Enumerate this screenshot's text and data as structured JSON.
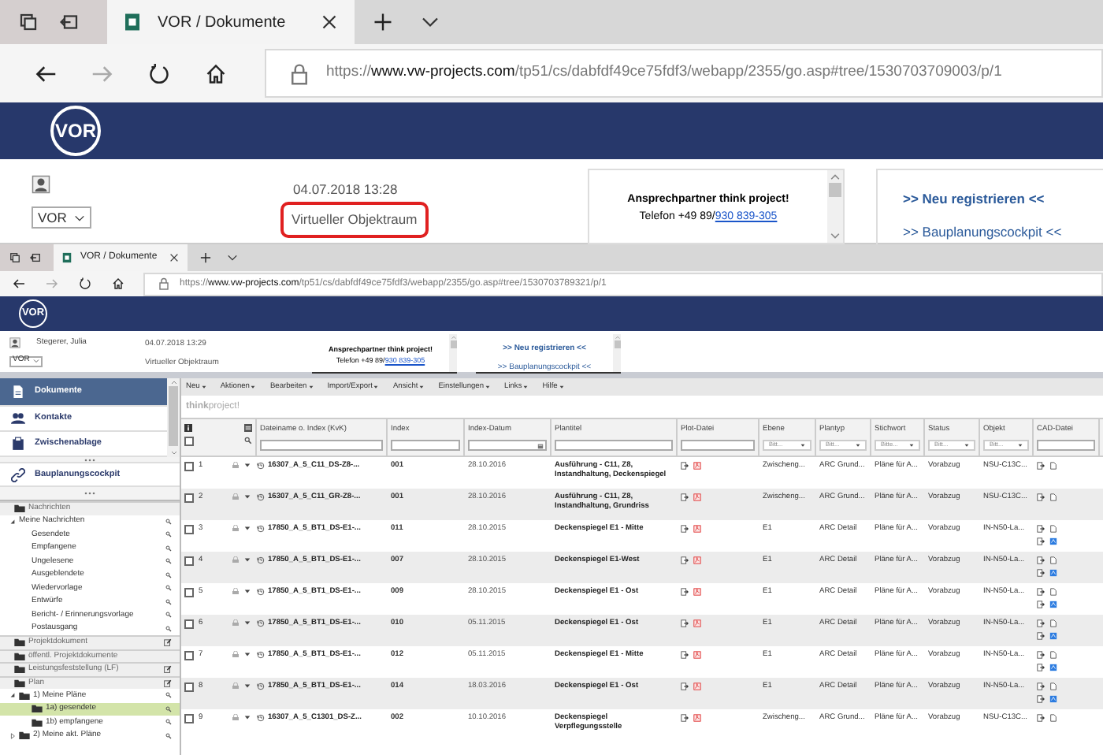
{
  "browser_outer": {
    "tab_title": "VOR / Dokumente",
    "url": {
      "scheme": "https://",
      "host": "www.vw-projects.com",
      "path": "/tp51/cs/dabfdf49ce75fdf3/webapp/2355/go.asp#tree/1530703709003/p/1"
    },
    "logo": "VOR",
    "project_select": "VOR",
    "date": "04.07.2018 13:28",
    "workspace": "Virtueller Objektraum",
    "workspace_highlighted": true,
    "contact": {
      "title": "Ansprechpartner think project!",
      "phone": "Telefon +49 89/",
      "phone_link": "930 839-305"
    },
    "links": [
      ">> Neu registrieren <<",
      ">> Bauplanungscockpit <<"
    ]
  },
  "browser_inner": {
    "tab_title": "VOR / Dokumente",
    "url": {
      "scheme": "https://",
      "host": "www.vw-projects.com",
      "path": "/tp51/cs/dabfdf49ce75fdf3/webapp/2355/go.asp#tree/1530703789321/p/1"
    },
    "logo": "VOR",
    "user": "Stegerer, Julia",
    "project_select": "VOR",
    "date": "04.07.2018 13:29",
    "workspace": "Virtueller Objektraum",
    "workspace_highlighted": false,
    "contact": {
      "title": "Ansprechpartner think project!",
      "phone": "Telefon +49 89/",
      "phone_link": "930 839-305"
    },
    "links": [
      ">> Neu registrieren <<",
      ">> Bauplanungscockpit <<"
    ]
  },
  "sidebar": {
    "nav": [
      {
        "label": "Dokumente",
        "kind": "document",
        "selected": true
      },
      {
        "label": "Kontakte",
        "kind": "contacts",
        "selected": false
      },
      {
        "label": "Zwischenablage",
        "kind": "clipboard",
        "selected": false
      }
    ],
    "cockpit": "Bauplanungscockpit",
    "tree": [
      {
        "label": "Nachrichten",
        "kind": "section",
        "selected": false,
        "children": [
          {
            "label": "Meine Nachrichten",
            "kind": "item",
            "search": true,
            "expanded": true,
            "selected": false,
            "children": [
              {
                "label": "Gesendete",
                "kind": "item",
                "search": true,
                "selected": false
              },
              {
                "label": "Empfangene",
                "kind": "item",
                "search": true,
                "selected": false
              },
              {
                "label": "Ungelesene",
                "kind": "item",
                "search": true,
                "selected": false
              },
              {
                "label": "Ausgeblendete",
                "kind": "item",
                "search": true,
                "selected": false
              },
              {
                "label": "Wiedervorlage",
                "kind": "item",
                "search": true,
                "selected": false
              },
              {
                "label": "Entwürfe",
                "kind": "item",
                "search": true,
                "selected": false
              },
              {
                "label": "Bericht- / Erinnerungsvorlage",
                "kind": "item",
                "search": true,
                "selected": false
              },
              {
                "label": "Postausgang",
                "kind": "item",
                "search": true,
                "selected": false
              }
            ]
          }
        ]
      },
      {
        "label": "Projektdokument",
        "kind": "section",
        "edit": true,
        "selected": false
      },
      {
        "label": "öffentl. Projektdokumente",
        "kind": "section",
        "selected": false
      },
      {
        "label": "Leistungsfeststellung (LF)",
        "kind": "section",
        "edit": true,
        "selected": false
      },
      {
        "label": "Plan",
        "kind": "section",
        "edit": true,
        "selected": false,
        "children": [
          {
            "label": "1) Meine Pläne",
            "kind": "folder",
            "search": true,
            "expanded": true,
            "selected": false,
            "children": [
              {
                "label": "1a) gesendete",
                "kind": "folder",
                "search": true,
                "selected": true
              },
              {
                "label": "1b) empfangene",
                "kind": "folder",
                "search": true,
                "selected": false
              }
            ]
          },
          {
            "label": "2) Meine akt. Pläne",
            "kind": "folder",
            "search": true,
            "expanded": false,
            "selected": false
          }
        ]
      }
    ]
  },
  "menu": [
    "Neu",
    "Aktionen",
    "Bearbeiten",
    "Import/Export",
    "Ansicht",
    "Einstellungen",
    "Links",
    "Hilfe"
  ],
  "brand": "**think**project!",
  "table": {
    "select_all_checked": false,
    "columns": [
      {
        "label": "Dateiname o. Index (KvK)",
        "kind": "text"
      },
      {
        "label": "Index",
        "kind": "text"
      },
      {
        "label": "Index-Datum",
        "kind": "date"
      },
      {
        "label": "Plantitel",
        "kind": "text"
      },
      {
        "label": "Plot-Datei",
        "kind": "text"
      },
      {
        "label": "Ebene",
        "kind": "select",
        "placeholder": "Bitt..."
      },
      {
        "label": "Plantyp",
        "kind": "select",
        "placeholder": "Bitt..."
      },
      {
        "label": "Stichwort",
        "kind": "select",
        "placeholder": "Bitte..."
      },
      {
        "label": "Status",
        "kind": "select",
        "placeholder": "Bitt..."
      },
      {
        "label": "Objekt",
        "kind": "select",
        "placeholder": "Bitt..."
      },
      {
        "label": "CAD-Datei",
        "kind": "text"
      }
    ],
    "rows": [
      {
        "num": "1",
        "checked": false,
        "file": "16307_A_5_C11_DS-Z8-...",
        "index": "001",
        "date": "28.10.2016",
        "title": "Ausführung - C11, Z8, Instandhaltung, Deckenspiegel",
        "ebene": "Zwischeng...",
        "plantyp": "ARC Grund...",
        "stichwort": "Pläne für A...",
        "status": "Vorabzug",
        "objekt": "NSU-C13C...",
        "cad_extra": false
      },
      {
        "num": "2",
        "checked": false,
        "file": "16307_A_5_C11_GR-Z8-...",
        "index": "001",
        "date": "28.10.2016",
        "title": "Ausführung - C11, Z8, Instandhaltung, Grundriss",
        "ebene": "Zwischeng...",
        "plantyp": "ARC Grund...",
        "stichwort": "Pläne für A...",
        "status": "Vorabzug",
        "objekt": "NSU-C13C...",
        "cad_extra": false
      },
      {
        "num": "3",
        "checked": false,
        "file": "17850_A_5_BT1_DS-E1-...",
        "index": "011",
        "date": "28.10.2015",
        "title": "Deckenspiegel E1 - Mitte",
        "ebene": "E1",
        "plantyp": "ARC Detail",
        "stichwort": "Pläne für A...",
        "status": "Vorabzug",
        "objekt": "IN-N50-La...",
        "cad_extra": true
      },
      {
        "num": "4",
        "checked": false,
        "file": "17850_A_5_BT1_DS-E1-...",
        "index": "007",
        "date": "28.10.2015",
        "title": "Deckenspiegel E1-West",
        "ebene": "E1",
        "plantyp": "ARC Detail",
        "stichwort": "Pläne für A...",
        "status": "Vorabzug",
        "objekt": "IN-N50-La...",
        "cad_extra": true
      },
      {
        "num": "5",
        "checked": false,
        "file": "17850_A_5_BT1_DS-E1-...",
        "index": "009",
        "date": "28.10.2015",
        "title": "Deckenspiegel E1 - Ost",
        "ebene": "E1",
        "plantyp": "ARC Detail",
        "stichwort": "Pläne für A...",
        "status": "Vorabzug",
        "objekt": "IN-N50-La...",
        "cad_extra": true
      },
      {
        "num": "6",
        "checked": false,
        "file": "17850_A_5_BT1_DS-E1-...",
        "index": "010",
        "date": "05.11.2015",
        "title": "Deckenspiegel E1 - Ost",
        "ebene": "E1",
        "plantyp": "ARC Detail",
        "stichwort": "Pläne für A...",
        "status": "Vorabzug",
        "objekt": "IN-N50-La...",
        "cad_extra": true
      },
      {
        "num": "7",
        "checked": false,
        "file": "17850_A_5_BT1_DS-E1-...",
        "index": "012",
        "date": "05.11.2015",
        "title": "Deckenspiegel E1 - Mitte",
        "ebene": "E1",
        "plantyp": "ARC Detail",
        "stichwort": "Pläne für A...",
        "status": "Vorabzug",
        "objekt": "IN-N50-La...",
        "cad_extra": true
      },
      {
        "num": "8",
        "checked": false,
        "file": "17850_A_5_BT1_DS-E1-...",
        "index": "014",
        "date": "18.03.2016",
        "title": "Deckenspiegel E1 - Ost",
        "ebene": "E1",
        "plantyp": "ARC Detail",
        "stichwort": "Pläne für A...",
        "status": "Vorabzug",
        "objekt": "IN-N50-La...",
        "cad_extra": true
      },
      {
        "num": "9",
        "checked": false,
        "file": "16307_A_5_C1301_DS-Z...",
        "index": "002",
        "date": "10.10.2016",
        "title": "Deckenspiegel Verpflegungsstelle",
        "ebene": "Zwischeng...",
        "plantyp": "ARC Grund...",
        "stichwort": "Pläne für A...",
        "status": "Vorabzug",
        "objekt": "NSU-C13C...",
        "cad_extra": false
      }
    ]
  }
}
